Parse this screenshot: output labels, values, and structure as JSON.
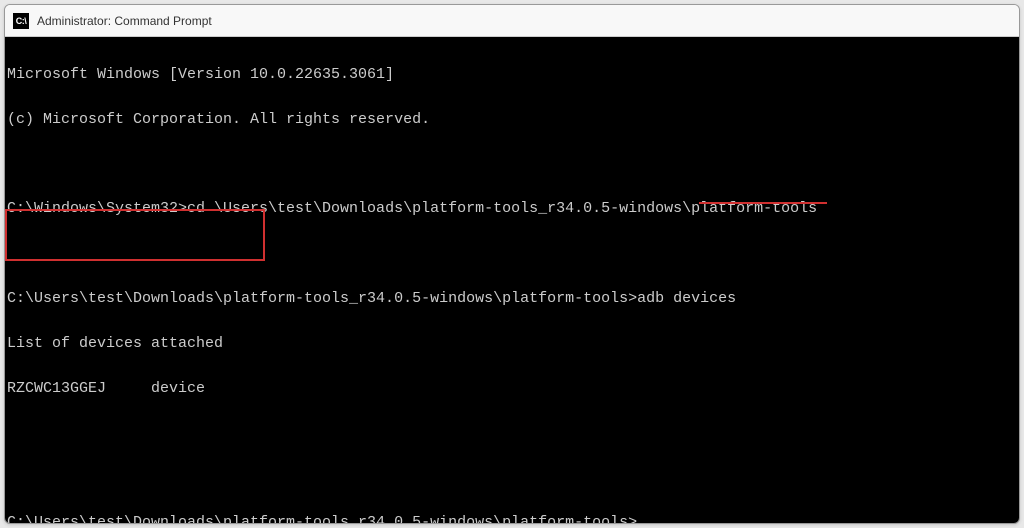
{
  "window": {
    "title": "Administrator: Command Prompt",
    "icon_label": "C:\\"
  },
  "terminal": {
    "line1": "Microsoft Windows [Version 10.0.22635.3061]",
    "line2": "(c) Microsoft Corporation. All rights reserved.",
    "prompt1": "C:\\Windows\\System32>",
    "cmd1": "cd \\Users\\test\\Downloads\\platform-tools_r34.0.5-windows\\platform-tools",
    "prompt2": "C:\\Users\\test\\Downloads\\platform-tools_r34.0.5-windows\\platform-tools>",
    "cmd2": "adb devices",
    "out1": "List of devices attached",
    "out2": "RZCWC13GGEJ     device",
    "prompt3": "C:\\Users\\test\\Downloads\\platform-tools_r34.0.5-windows\\platform-tools>"
  }
}
